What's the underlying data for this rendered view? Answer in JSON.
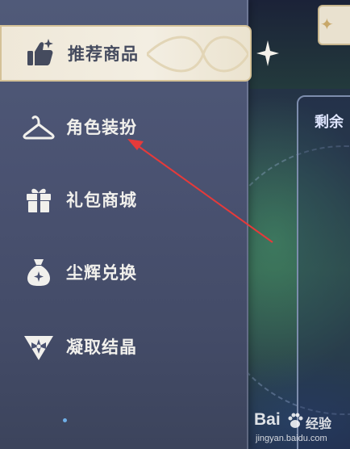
{
  "header": {
    "panel_title": "剩余"
  },
  "sidebar": {
    "items": [
      {
        "label": "推荐商品",
        "icon": "thumbs-up-sparkle-icon",
        "active": true
      },
      {
        "label": "角色装扮",
        "icon": "hanger-icon",
        "active": false
      },
      {
        "label": "礼包商城",
        "icon": "gift-box-icon",
        "active": false
      },
      {
        "label": "尘辉兑换",
        "icon": "money-bag-icon",
        "active": false
      },
      {
        "label": "凝取结晶",
        "icon": "crystal-emblem-icon",
        "active": false
      }
    ]
  },
  "annotation": {
    "type": "red-arrow",
    "target": "角色装扮"
  },
  "watermark": {
    "logo": "Bai",
    "logo_suffix": "经验",
    "url": "jingyan.baidu.com"
  },
  "colors": {
    "active_bg": "#f0e9d9",
    "active_border": "#d4c197",
    "sidebar_bg": "#4a5271",
    "arrow": "#e63a3a"
  }
}
